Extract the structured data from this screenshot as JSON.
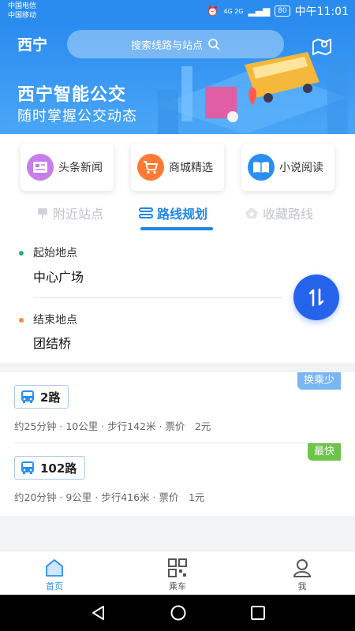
{
  "status_bar": {
    "carrier_1": "中国电信",
    "carrier_2": "中国移动",
    "network": "4G 2G",
    "battery": "80",
    "time": "中午11:01"
  },
  "header": {
    "city": "西宁",
    "search_placeholder": "搜索线路与站点",
    "banner_title": "西宁智能公交",
    "banner_subtitle": "随时掌握公交动态"
  },
  "quick_links": [
    {
      "label": "头条新闻",
      "icon": "news-icon",
      "color": "#c77dea"
    },
    {
      "label": "商城精选",
      "icon": "shopping-cart-icon",
      "color": "#ff7a33"
    },
    {
      "label": "小说阅读",
      "icon": "book-icon",
      "color": "#2a8ff0"
    }
  ],
  "tabs": [
    {
      "label": "附近站点",
      "icon": "bus-stop-icon",
      "active": false
    },
    {
      "label": "路线规划",
      "icon": "route-icon",
      "active": true
    },
    {
      "label": "收藏路线",
      "icon": "favorite-route-icon",
      "active": false
    }
  ],
  "route": {
    "start_label": "起始地点",
    "start_value": "中心广场",
    "end_label": "结束地点",
    "end_value": "团结桥",
    "start_color": "#22b573",
    "end_color": "#f58a42"
  },
  "results": [
    {
      "badge": "换乘少",
      "badge_color": "#7ab6f2",
      "line": "2路",
      "meta": "约25分钟 · 10公里 · 步行142米 · 票价　2元"
    },
    {
      "badge": "最快",
      "badge_color": "#6cc44a",
      "line": "102路",
      "meta": "约20分钟 · 9公里 · 步行416米 · 票价　1元"
    }
  ],
  "bottom_nav": [
    {
      "label": "首页",
      "icon": "home-icon",
      "active": true
    },
    {
      "label": "乘车",
      "icon": "qr-code-icon",
      "active": false
    },
    {
      "label": "我",
      "icon": "profile-icon",
      "active": false
    }
  ]
}
